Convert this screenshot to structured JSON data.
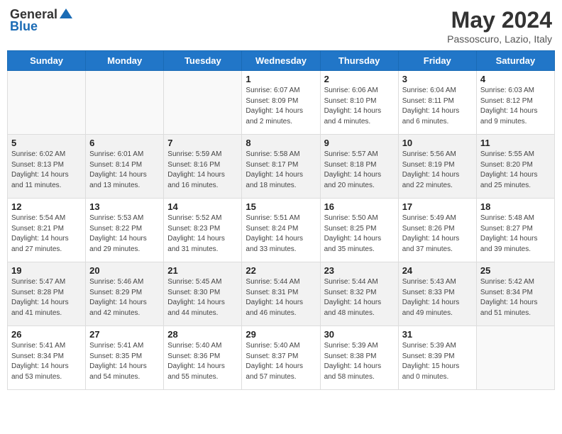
{
  "header": {
    "logo_general": "General",
    "logo_blue": "Blue",
    "month_year": "May 2024",
    "location": "Passoscuro, Lazio, Italy"
  },
  "days_of_week": [
    "Sunday",
    "Monday",
    "Tuesday",
    "Wednesday",
    "Thursday",
    "Friday",
    "Saturday"
  ],
  "weeks": [
    {
      "shaded": false,
      "days": [
        {
          "number": "",
          "info": ""
        },
        {
          "number": "",
          "info": ""
        },
        {
          "number": "",
          "info": ""
        },
        {
          "number": "1",
          "info": "Sunrise: 6:07 AM\nSunset: 8:09 PM\nDaylight: 14 hours\nand 2 minutes."
        },
        {
          "number": "2",
          "info": "Sunrise: 6:06 AM\nSunset: 8:10 PM\nDaylight: 14 hours\nand 4 minutes."
        },
        {
          "number": "3",
          "info": "Sunrise: 6:04 AM\nSunset: 8:11 PM\nDaylight: 14 hours\nand 6 minutes."
        },
        {
          "number": "4",
          "info": "Sunrise: 6:03 AM\nSunset: 8:12 PM\nDaylight: 14 hours\nand 9 minutes."
        }
      ]
    },
    {
      "shaded": true,
      "days": [
        {
          "number": "5",
          "info": "Sunrise: 6:02 AM\nSunset: 8:13 PM\nDaylight: 14 hours\nand 11 minutes."
        },
        {
          "number": "6",
          "info": "Sunrise: 6:01 AM\nSunset: 8:14 PM\nDaylight: 14 hours\nand 13 minutes."
        },
        {
          "number": "7",
          "info": "Sunrise: 5:59 AM\nSunset: 8:16 PM\nDaylight: 14 hours\nand 16 minutes."
        },
        {
          "number": "8",
          "info": "Sunrise: 5:58 AM\nSunset: 8:17 PM\nDaylight: 14 hours\nand 18 minutes."
        },
        {
          "number": "9",
          "info": "Sunrise: 5:57 AM\nSunset: 8:18 PM\nDaylight: 14 hours\nand 20 minutes."
        },
        {
          "number": "10",
          "info": "Sunrise: 5:56 AM\nSunset: 8:19 PM\nDaylight: 14 hours\nand 22 minutes."
        },
        {
          "number": "11",
          "info": "Sunrise: 5:55 AM\nSunset: 8:20 PM\nDaylight: 14 hours\nand 25 minutes."
        }
      ]
    },
    {
      "shaded": false,
      "days": [
        {
          "number": "12",
          "info": "Sunrise: 5:54 AM\nSunset: 8:21 PM\nDaylight: 14 hours\nand 27 minutes."
        },
        {
          "number": "13",
          "info": "Sunrise: 5:53 AM\nSunset: 8:22 PM\nDaylight: 14 hours\nand 29 minutes."
        },
        {
          "number": "14",
          "info": "Sunrise: 5:52 AM\nSunset: 8:23 PM\nDaylight: 14 hours\nand 31 minutes."
        },
        {
          "number": "15",
          "info": "Sunrise: 5:51 AM\nSunset: 8:24 PM\nDaylight: 14 hours\nand 33 minutes."
        },
        {
          "number": "16",
          "info": "Sunrise: 5:50 AM\nSunset: 8:25 PM\nDaylight: 14 hours\nand 35 minutes."
        },
        {
          "number": "17",
          "info": "Sunrise: 5:49 AM\nSunset: 8:26 PM\nDaylight: 14 hours\nand 37 minutes."
        },
        {
          "number": "18",
          "info": "Sunrise: 5:48 AM\nSunset: 8:27 PM\nDaylight: 14 hours\nand 39 minutes."
        }
      ]
    },
    {
      "shaded": true,
      "days": [
        {
          "number": "19",
          "info": "Sunrise: 5:47 AM\nSunset: 8:28 PM\nDaylight: 14 hours\nand 41 minutes."
        },
        {
          "number": "20",
          "info": "Sunrise: 5:46 AM\nSunset: 8:29 PM\nDaylight: 14 hours\nand 42 minutes."
        },
        {
          "number": "21",
          "info": "Sunrise: 5:45 AM\nSunset: 8:30 PM\nDaylight: 14 hours\nand 44 minutes."
        },
        {
          "number": "22",
          "info": "Sunrise: 5:44 AM\nSunset: 8:31 PM\nDaylight: 14 hours\nand 46 minutes."
        },
        {
          "number": "23",
          "info": "Sunrise: 5:44 AM\nSunset: 8:32 PM\nDaylight: 14 hours\nand 48 minutes."
        },
        {
          "number": "24",
          "info": "Sunrise: 5:43 AM\nSunset: 8:33 PM\nDaylight: 14 hours\nand 49 minutes."
        },
        {
          "number": "25",
          "info": "Sunrise: 5:42 AM\nSunset: 8:34 PM\nDaylight: 14 hours\nand 51 minutes."
        }
      ]
    },
    {
      "shaded": false,
      "days": [
        {
          "number": "26",
          "info": "Sunrise: 5:41 AM\nSunset: 8:34 PM\nDaylight: 14 hours\nand 53 minutes."
        },
        {
          "number": "27",
          "info": "Sunrise: 5:41 AM\nSunset: 8:35 PM\nDaylight: 14 hours\nand 54 minutes."
        },
        {
          "number": "28",
          "info": "Sunrise: 5:40 AM\nSunset: 8:36 PM\nDaylight: 14 hours\nand 55 minutes."
        },
        {
          "number": "29",
          "info": "Sunrise: 5:40 AM\nSunset: 8:37 PM\nDaylight: 14 hours\nand 57 minutes."
        },
        {
          "number": "30",
          "info": "Sunrise: 5:39 AM\nSunset: 8:38 PM\nDaylight: 14 hours\nand 58 minutes."
        },
        {
          "number": "31",
          "info": "Sunrise: 5:39 AM\nSunset: 8:39 PM\nDaylight: 15 hours\nand 0 minutes."
        },
        {
          "number": "",
          "info": ""
        }
      ]
    }
  ]
}
